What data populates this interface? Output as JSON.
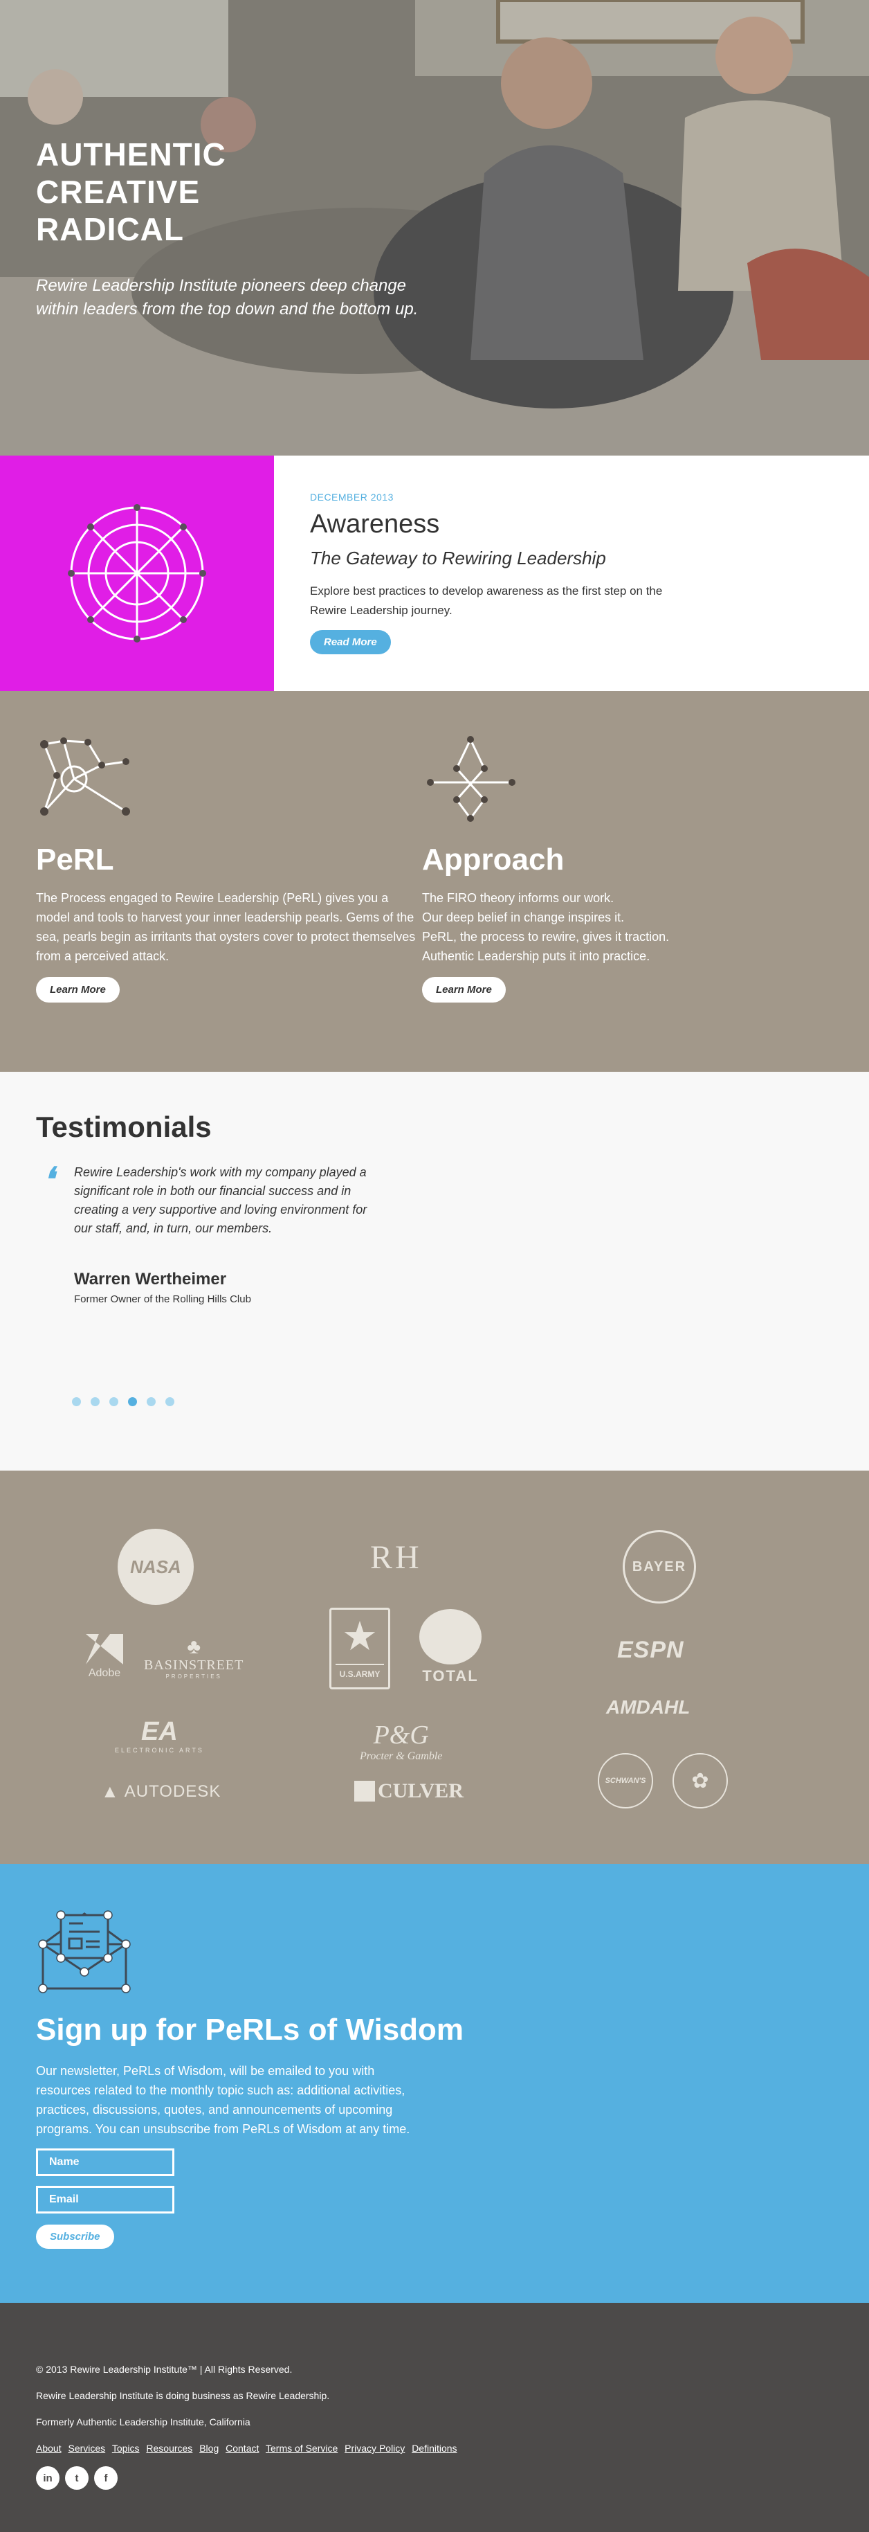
{
  "hero": {
    "heading": [
      "AUTHENTIC",
      "CREATIVE",
      "RADICAL"
    ],
    "tagline": "Rewire Leadership Institute pioneers deep change within leaders from the top down and the bottom up."
  },
  "awareness": {
    "date": "DECEMBER 2013",
    "title": "Awareness",
    "subtitle": "The Gateway to Rewiring Leadership",
    "text": "Explore best practices to develop awareness as the first step on the Rewire Leadership journey.",
    "button": "Read More",
    "accent": "#e01ee6"
  },
  "perl": {
    "title": "PeRL",
    "text": "The Process engaged to Rewire Leadership (PeRL) gives you a model and tools to harvest your inner leadership pearls. Gems of the sea, pearls begin as irritants that oysters cover to protect themselves from a perceived attack.",
    "button": "Learn More"
  },
  "approach": {
    "title": "Approach",
    "lines": [
      "The FIRO theory informs our work.",
      "Our deep belief in change inspires it.",
      "PeRL, the process to rewire, gives it traction.",
      "Authentic Leadership puts it into practice."
    ],
    "button": "Learn More"
  },
  "testimonials": {
    "title": "Testimonials",
    "quote": "Rewire Leadership's work with my company played a significant role in both our financial success and in creating a very supportive and loving environment for our staff, and, in turn, our members.",
    "author": "Warren Wertheimer",
    "role": "Former Owner of the Rolling Hills Club",
    "slide_count": 6,
    "active_slide": 3
  },
  "logos": {
    "nasa": "NASA",
    "rh": "RH",
    "bayer": "BAYER",
    "adobe": "Adobe",
    "basinstreet": "BASINSTREET",
    "basinstreet_sub": "PROPERTIES",
    "usarmy": "U.S.ARMY",
    "total": "TOTAL",
    "espn": "ESPN",
    "amdahl": "AMDAHL",
    "ea": "EA",
    "ea_sub": "ELECTRONIC ARTS",
    "pg": "P&G",
    "pg_sub": "Procter & Gamble",
    "autodesk": "AUTODESK",
    "culver": "CULVER",
    "schwans": "SCHWAN'S"
  },
  "signup": {
    "title": "Sign up for PeRLs of Wisdom",
    "text": "Our newsletter, PeRLs of Wisdom, will be emailed to you with resources related to the monthly topic such as: additional activities, practices, discussions, quotes, and announcements of upcoming programs. You can unsubscribe from PeRLs of Wisdom at any time.",
    "name_placeholder": "Name",
    "email_placeholder": "Email",
    "button": "Subscribe"
  },
  "footer": {
    "copyright": "© 2013 Rewire Leadership Institute™ | All Rights Reserved.",
    "dba": "Rewire Leadership Institute is doing business as Rewire Leadership.",
    "formerly": "Formerly Authentic Leadership Institute, California",
    "links": [
      "About",
      "Services",
      "Topics",
      "Resources",
      "Blog",
      "Contact",
      "Terms of Service",
      "Privacy Policy",
      "Definitions"
    ],
    "social": [
      "in",
      "t",
      "f"
    ]
  }
}
